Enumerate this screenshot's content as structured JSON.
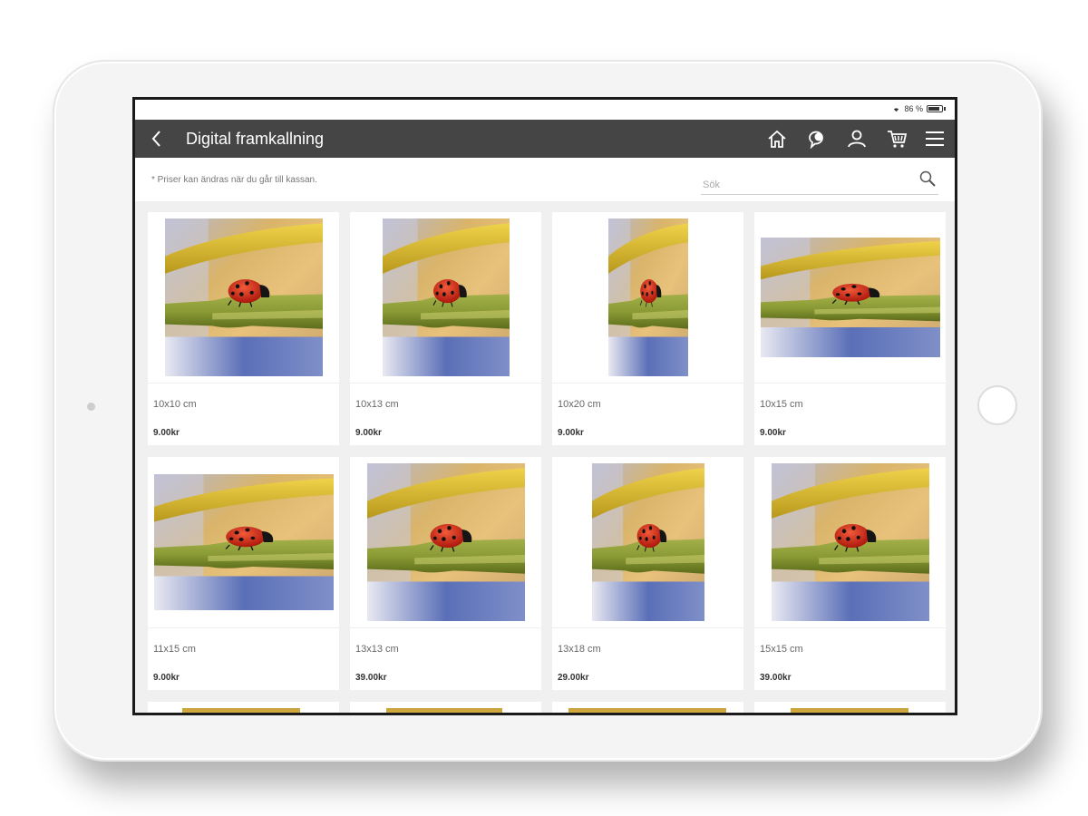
{
  "status": {
    "battery": "86 %",
    "battery_level": 0.86
  },
  "nav": {
    "title": "Digital framkallning",
    "icons": [
      "home-icon",
      "chat-icon",
      "user-icon",
      "cart-icon",
      "menu-icon"
    ]
  },
  "filter": {
    "note": "* Priser kan ändras när du går till kassan.",
    "search_placeholder": "Sök"
  },
  "products": [
    {
      "size": "10x10 cm",
      "price": "9.00kr"
    },
    {
      "size": "10x13 cm",
      "price": "9.00kr"
    },
    {
      "size": "10x20 cm",
      "price": "9.00kr"
    },
    {
      "size": "10x15 cm",
      "price": "9.00kr"
    },
    {
      "size": "11x15 cm",
      "price": "9.00kr"
    },
    {
      "size": "13x13 cm",
      "price": "39.00kr"
    },
    {
      "size": "13x18 cm",
      "price": "29.00kr"
    },
    {
      "size": "15x15 cm",
      "price": "39.00kr"
    }
  ],
  "colors": {
    "nav_bg": "#454545",
    "page_bg": "#f0f0f0",
    "card_bg": "#ffffff"
  }
}
